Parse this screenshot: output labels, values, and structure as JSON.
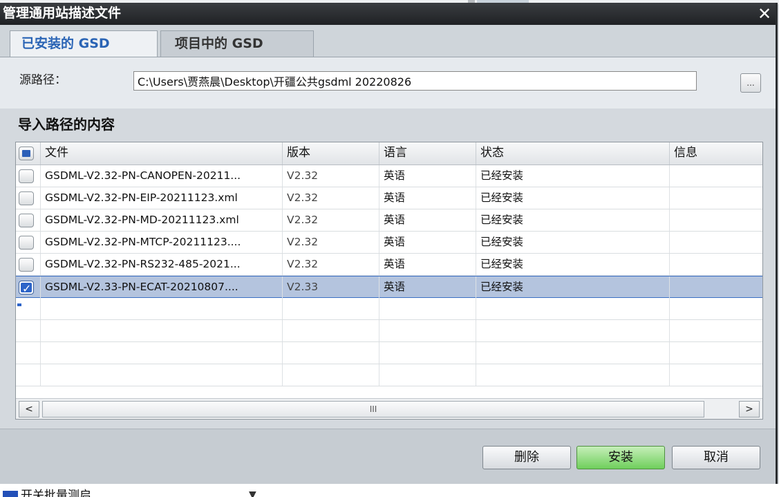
{
  "window": {
    "title": "管理通用站描述文件",
    "close_glyph": "✕"
  },
  "tabs": [
    {
      "label": "已安装的 GSD",
      "active": true
    },
    {
      "label": "项目中的 GSD",
      "active": false
    }
  ],
  "source": {
    "label": "源路径：",
    "path": "C:\\Users\\贾燕晨\\Desktop\\开疆公共gsdml 20220826",
    "browse_label": "..."
  },
  "section_title": "导入路径的内容",
  "table": {
    "columns": [
      "文件",
      "版本",
      "语言",
      "状态",
      "信息"
    ],
    "rows": [
      {
        "file": "GSDML-V2.32-PN-CANOPEN-20211...",
        "version": "V2.32",
        "language": "英语",
        "status": "已经安装",
        "info": "",
        "checked": false
      },
      {
        "file": "GSDML-V2.32-PN-EIP-20211123.xml",
        "version": "V2.32",
        "language": "英语",
        "status": "已经安装",
        "info": "",
        "checked": false
      },
      {
        "file": "GSDML-V2.32-PN-MD-20211123.xml",
        "version": "V2.32",
        "language": "英语",
        "status": "已经安装",
        "info": "",
        "checked": false
      },
      {
        "file": "GSDML-V2.32-PN-MTCP-20211123....",
        "version": "V2.32",
        "language": "英语",
        "status": "已经安装",
        "info": "",
        "checked": false
      },
      {
        "file": "GSDML-V2.32-PN-RS232-485-2021...",
        "version": "V2.32",
        "language": "英语",
        "status": "已经安装",
        "info": "",
        "checked": false
      },
      {
        "file": "GSDML-V2.33-PN-ECAT-20210807....",
        "version": "V2.33",
        "language": "英语",
        "status": "已经安装",
        "info": "",
        "checked": true
      }
    ],
    "scroll_thumb_grip": "III",
    "scroll_left": "<",
    "scroll_right": ">"
  },
  "buttons": {
    "delete": "删除",
    "install": "安装",
    "cancel": "取消"
  },
  "background_window": {
    "text": "开关批量测启",
    "arrow": "▼"
  },
  "colors": {
    "title_bar": "#2a2c2f",
    "active_tab_text": "#2a64b5",
    "selected_row": "#b4c4de",
    "install_button": "#6fcf5c"
  }
}
